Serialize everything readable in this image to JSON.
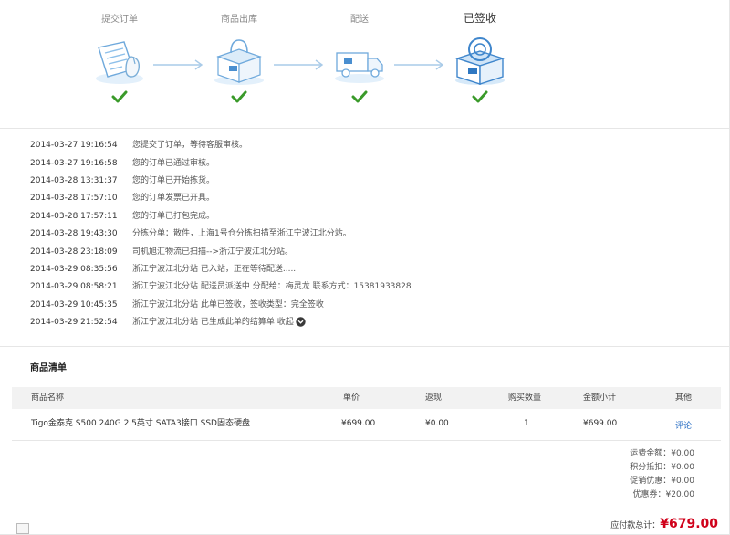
{
  "steps": [
    {
      "label": "提交订单",
      "icon": "order-form-icon"
    },
    {
      "label": "商品出库",
      "icon": "package-icon"
    },
    {
      "label": "配送",
      "icon": "delivery-truck-icon"
    },
    {
      "label": "已签收",
      "icon": "signed-package-icon"
    }
  ],
  "colors": {
    "check": "#3a9a2a",
    "accent": "#2a6fc4",
    "price_red": "#d0021b"
  },
  "log": [
    {
      "time": "2014-03-27 19:16:54",
      "text": "您提交了订单，等待客服审核。"
    },
    {
      "time": "2014-03-27 19:16:58",
      "text": "您的订单已通过审核。"
    },
    {
      "time": "2014-03-28 13:31:37",
      "text": "您的订单已开始拣货。"
    },
    {
      "time": "2014-03-28 17:57:10",
      "text": "您的订单发票已开具。"
    },
    {
      "time": "2014-03-28 17:57:11",
      "text": "您的订单已打包完成。"
    },
    {
      "time": "2014-03-28 19:43:30",
      "text": "分拣分单：散件，上海1号仓分拣扫描至浙江宁波江北分站。"
    },
    {
      "time": "2014-03-28 23:18:09",
      "text": "司机旭汇物流已扫描-->浙江宁波江北分站。"
    },
    {
      "time": "2014-03-29 08:35:56",
      "text": "浙江宁波江北分站 已入站，正在等待配送......"
    },
    {
      "time": "2014-03-29 08:58:21",
      "text": "浙江宁波江北分站 配送员派送中 分配给：梅灵龙 联系方式：15381933828"
    },
    {
      "time": "2014-03-29 10:45:35",
      "text": "浙江宁波江北分站 此单已签收，签收类型：完全签收"
    },
    {
      "time": "2014-03-29 21:52:54",
      "text": "浙江宁波江北分站 已生成此单的结算单 收起"
    }
  ],
  "products": {
    "title": "商品清单",
    "headers": {
      "name": "商品名称",
      "price": "单价",
      "rebate": "返现",
      "qty": "购买数量",
      "subtotal": "金额小计",
      "other": "其他"
    },
    "rows": [
      {
        "name": "Tigo金泰克 S500 240G 2.5英寸 SATA3接口 SSD固态硬盘",
        "price": "¥699.00",
        "rebate": "¥0.00",
        "qty": "1",
        "subtotal": "¥699.00",
        "action": "评论"
      }
    ]
  },
  "summary": {
    "shipping": "运费金额：¥0.00",
    "points": "积分抵扣：¥0.00",
    "promo": "促销优惠：¥0.00",
    "coupon": "优惠券：¥20.00",
    "total_label": "应付款总计：",
    "total_value": "¥679.00"
  }
}
